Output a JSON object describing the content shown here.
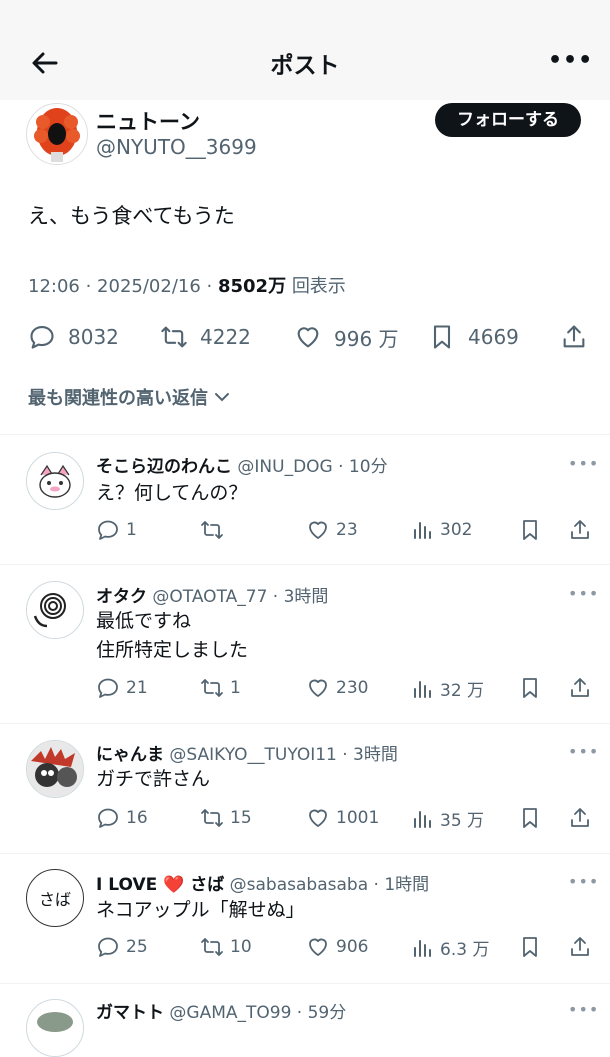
{
  "header": {
    "title": "ポスト"
  },
  "post": {
    "author_name": "ニュトーン",
    "author_handle": "@NYUTO__3699",
    "follow_label": "フォローする",
    "text": "え、もう食べてもうた",
    "time": "12:06 · 2025/02/16 ·",
    "views_count": "8502万",
    "views_label": "回表示",
    "replies": "8032",
    "reposts": "4222",
    "likes": "996 万",
    "bookmarks": "4669"
  },
  "sort_label": "最も関連性の高い返信",
  "replies": [
    {
      "name": "そこら辺のわんこ",
      "handle": "@INU_DOG · 10分",
      "lines": [
        "え？何してんの？"
      ],
      "reply_count": "1",
      "repost_count": "",
      "like_count": "23",
      "view_count": "302"
    },
    {
      "name": "オタク",
      "handle": "@OTAOTA_77 · 3時間",
      "lines": [
        "最低ですね",
        "住所特定しました"
      ],
      "reply_count": "21",
      "repost_count": "1",
      "like_count": "230",
      "view_count": "32 万"
    },
    {
      "name": "にゃんま",
      "handle": "@SAIKYO__TUYOI11 · 3時間",
      "lines": [
        "ガチで許さん"
      ],
      "reply_count": "16",
      "repost_count": "15",
      "like_count": "1001",
      "view_count": "35 万"
    },
    {
      "name": "I LOVE ❤️ さば",
      "handle": "@sabasabasaba · 1時間",
      "lines": [
        "ネコアップル「解せぬ」"
      ],
      "avatar_text": "さば",
      "reply_count": "25",
      "repost_count": "10",
      "like_count": "906",
      "view_count": "6.3 万"
    },
    {
      "name": "ガマトト",
      "handle": "@GAMA_TO99 · 59分",
      "lines": [],
      "reply_count": "",
      "repost_count": "",
      "like_count": "",
      "view_count": ""
    }
  ],
  "colors": {
    "text": "#0f1419",
    "secondary": "#536471",
    "follow_bg": "#0f1419",
    "like": "#f91880"
  }
}
